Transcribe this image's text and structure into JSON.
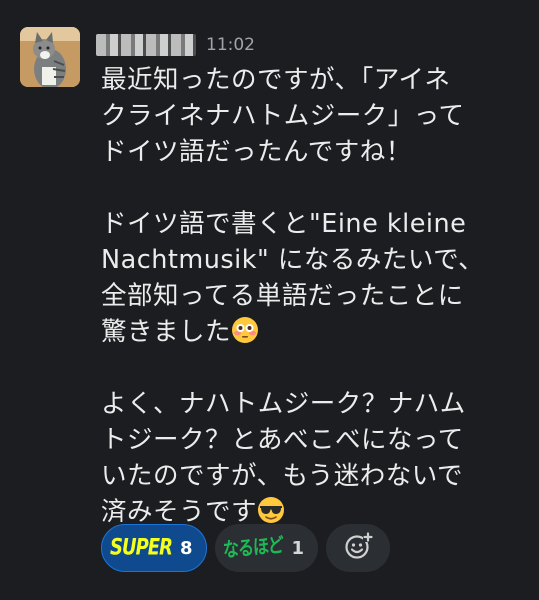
{
  "message": {
    "timestamp": "11:02",
    "lines": [
      "最近知ったのですが、「アイネ",
      "クライネナハトムジーク」って",
      "ドイツ語だったんですね！",
      "",
      "ドイツ語で書くと\"Eine kleine",
      "Nachtmusik\" になるみたいで、",
      "全部知ってる単語だったことに",
      "驚きました",
      "",
      "よく、ナハトムジーク？ナハム",
      "トジーク？とあべこべになって",
      "いたのですが、もう迷わないで",
      "済みそうです"
    ],
    "emoji_after_line_8": "flushed-face-emoji",
    "emoji_after_line_13": "sunglasses-face-emoji"
  },
  "reactions": [
    {
      "emoji_text": "SUPER",
      "count": "8",
      "color": "#f5ff1e",
      "active": true
    },
    {
      "emoji_text": "なるほど",
      "count": "1",
      "color": "#1db954",
      "active": false
    }
  ],
  "add_reaction_icon": "add-reaction-icon",
  "colors": {
    "background": "#1b1d21",
    "active_reaction_bg": "#0e4a8d",
    "pill_bg": "#2b2e33"
  }
}
